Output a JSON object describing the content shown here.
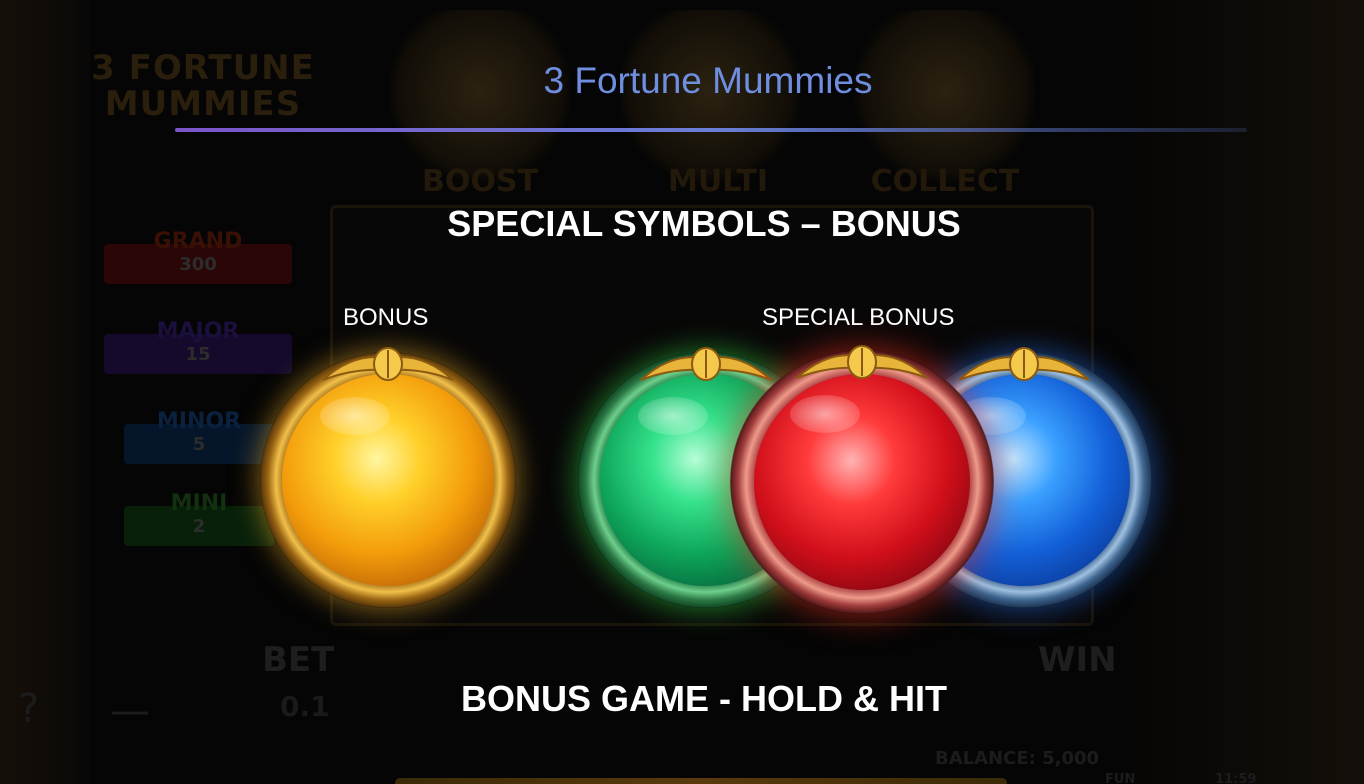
{
  "background": {
    "logo_text": "3 FORTUNE MUMMIES",
    "jackpots": [
      {
        "name": "GRAND",
        "value": "300"
      },
      {
        "name": "MAJOR",
        "value": "15"
      },
      {
        "name": "MINOR",
        "value": "5"
      },
      {
        "name": "MINI",
        "value": "2"
      }
    ],
    "reel_tags": [
      "BOOST",
      "MULTI",
      "COLLECT"
    ],
    "bet_label": "BET",
    "bet_value": "0.1",
    "win_label": "WIN",
    "balance": "BALANCE: 5,000",
    "fun_label": "FUN",
    "time": "11:59"
  },
  "paytable": {
    "title": "3 Fortune Mummies",
    "section_heading": "SPECIAL SYMBOLS – BONUS",
    "bonus_label": "BONUS",
    "special_bonus_label": "SPECIAL BONUS",
    "bonus_game_heading": "BONUS GAME - HOLD & HIT"
  },
  "symbols": [
    {
      "name": "bonus-orb",
      "color": "#f5a40e",
      "group": "BONUS"
    },
    {
      "name": "green-special-orb",
      "color": "#1cc36f",
      "group": "SPECIAL BONUS"
    },
    {
      "name": "red-special-orb",
      "color": "#e0141f",
      "group": "SPECIAL BONUS"
    },
    {
      "name": "blue-special-orb",
      "color": "#1a6fe8",
      "group": "SPECIAL BONUS"
    }
  ],
  "colors": {
    "title": "#6f8ee0",
    "divider_start": "#7c55c8",
    "divider_end": "#6a7fd8"
  }
}
